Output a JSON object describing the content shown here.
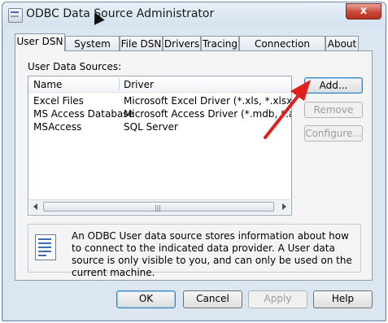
{
  "window": {
    "title": "ODBC Data Source Administrator",
    "close_glyph": "x"
  },
  "tabs": [
    {
      "label": "User DSN",
      "active": true
    },
    {
      "label": "System DSN"
    },
    {
      "label": "File DSN"
    },
    {
      "label": "Drivers"
    },
    {
      "label": "Tracing"
    },
    {
      "label": "Connection Pooling"
    },
    {
      "label": "About"
    }
  ],
  "panel": {
    "user_data_sources_label": "User Data Sources:",
    "columns": {
      "name": "Name",
      "driver": "Driver"
    },
    "rows": [
      {
        "name": "Excel Files",
        "driver": "Microsoft Excel Driver (*.xls, *.xlsx, *.xlsm, *.x"
      },
      {
        "name": "MS Access Database",
        "driver": "Microsoft Access Driver (*.mdb, *.accdb)"
      },
      {
        "name": "MSAccess",
        "driver": "SQL Server"
      }
    ],
    "buttons": {
      "add": "Add...",
      "remove": "Remove",
      "configure": "Configure..."
    },
    "info_text": "An ODBC User data source stores information about how to connect to the indicated data provider.   A User data source is only visible to you, and can only be used on the current machine."
  },
  "footer_buttons": {
    "ok": "OK",
    "cancel": "Cancel",
    "apply": "Apply",
    "help": "Help"
  },
  "colors": {
    "annotation_arrow": "#e0201b",
    "window_bg": "#dbe6f1",
    "panel_bg": "#f4f4f4"
  },
  "icons": [
    "odbc-app-icon",
    "close-icon",
    "mouse-cursor-icon",
    "data-source-info-icon",
    "annotation-arrow"
  ]
}
